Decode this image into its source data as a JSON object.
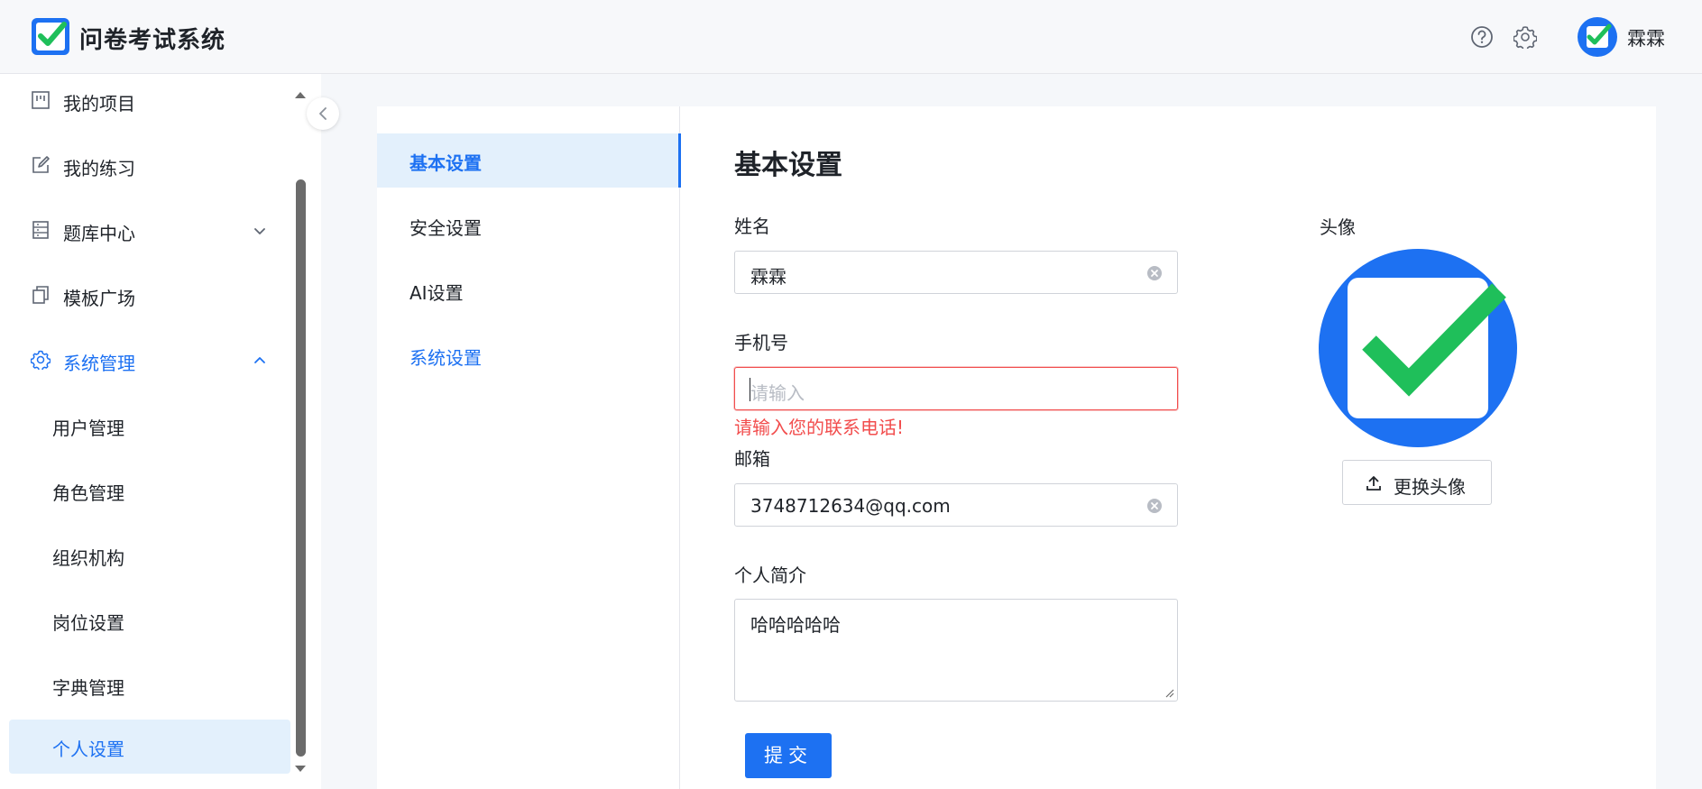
{
  "app": {
    "title": "问卷考试系统",
    "user_name": "霖霖",
    "colors": {
      "primary": "#1d71f2",
      "error": "#f24d4d",
      "logo_check": "#1fbf5a"
    }
  },
  "header": {
    "icons": [
      "help-icon",
      "settings-icon"
    ]
  },
  "sidebar": {
    "items": [
      {
        "label": "我的项目",
        "icon": "project-icon"
      },
      {
        "label": "我的练习",
        "icon": "edit-icon"
      },
      {
        "label": "题库中心",
        "icon": "question-bank-icon",
        "expanded": false
      },
      {
        "label": "模板广场",
        "icon": "template-icon"
      },
      {
        "label": "系统管理",
        "icon": "gear-icon",
        "expanded": true
      },
      {
        "label": "用户管理"
      },
      {
        "label": "角色管理"
      },
      {
        "label": "组织机构"
      },
      {
        "label": "岗位设置"
      },
      {
        "label": "字典管理"
      },
      {
        "label": "个人设置",
        "selected": true
      }
    ]
  },
  "settings_nav": {
    "items": [
      {
        "label": "基本设置",
        "active": true
      },
      {
        "label": "安全设置"
      },
      {
        "label": "AI设置"
      },
      {
        "label": "系统设置"
      }
    ]
  },
  "form": {
    "section_title": "基本设置",
    "name": {
      "label": "姓名",
      "value": "霖霖"
    },
    "phone": {
      "label": "手机号",
      "value": "",
      "placeholder": "请输入",
      "error": "请输入您的联系电话!"
    },
    "email": {
      "label": "邮箱",
      "value": "3748712634@qq.com"
    },
    "bio": {
      "label": "个人简介",
      "value": "哈哈哈哈哈"
    },
    "submit_label": "提交"
  },
  "avatar": {
    "label": "头像",
    "change_label": "更换头像"
  }
}
